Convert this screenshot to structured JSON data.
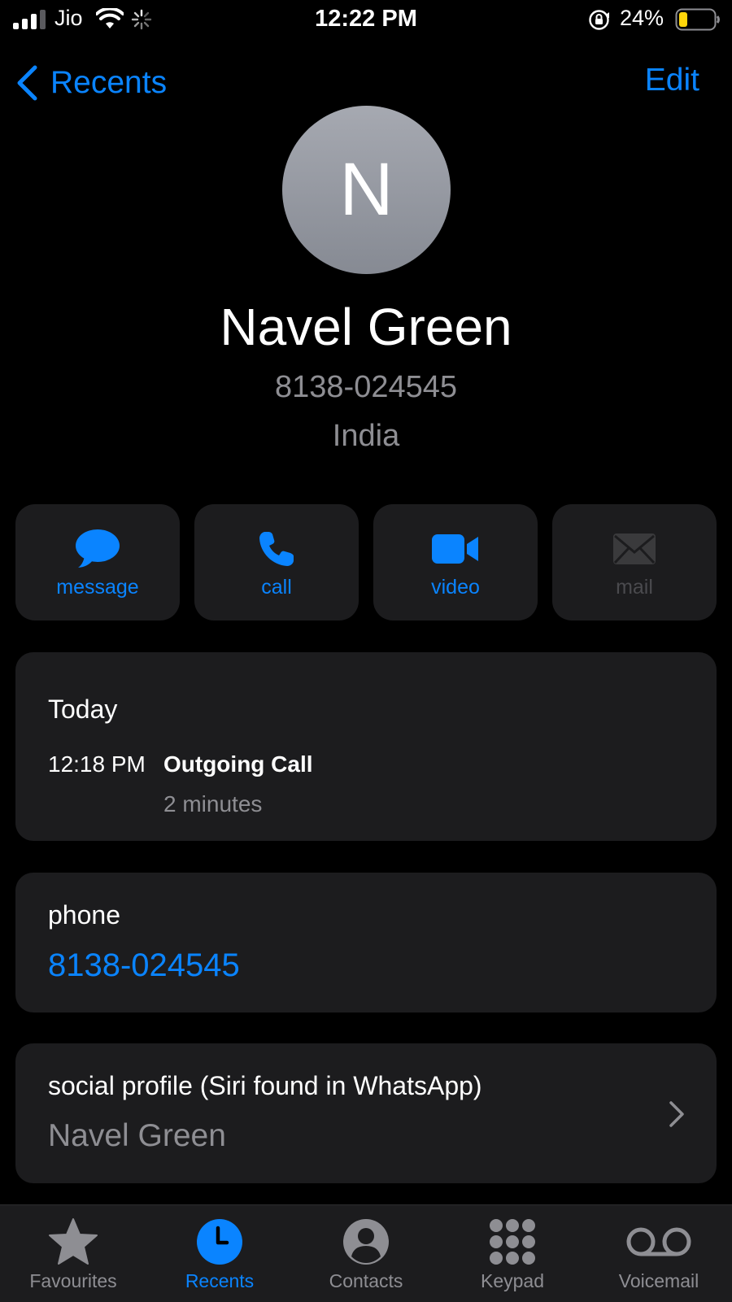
{
  "status_bar": {
    "carrier": "Jio",
    "time": "12:22 PM",
    "battery_percent": "24%",
    "battery_level": 0.24,
    "battery_color": "#ffd60a"
  },
  "nav": {
    "back_label": "Recents",
    "edit_label": "Edit"
  },
  "contact": {
    "initial": "N",
    "name": "Navel Green",
    "number": "8138-024545",
    "country": "India"
  },
  "actions": [
    {
      "label": "message",
      "icon": "message-bubble-icon",
      "enabled": true
    },
    {
      "label": "call",
      "icon": "phone-icon",
      "enabled": true
    },
    {
      "label": "video",
      "icon": "video-camera-icon",
      "enabled": true
    },
    {
      "label": "mail",
      "icon": "mail-envelope-icon",
      "enabled": false
    }
  ],
  "recent_call": {
    "day": "Today",
    "time": "12:18 PM",
    "type": "Outgoing Call",
    "duration": "2 minutes"
  },
  "phone_field": {
    "label": "phone",
    "value": "8138-024545"
  },
  "social_profile": {
    "label": "social profile (Siri found in WhatsApp)",
    "name": "Navel Green"
  },
  "tab_bar": {
    "active": "Recents",
    "tabs": [
      {
        "label": "Favourites",
        "icon": "star-icon"
      },
      {
        "label": "Recents",
        "icon": "clock-icon"
      },
      {
        "label": "Contacts",
        "icon": "person-circle-icon"
      },
      {
        "label": "Keypad",
        "icon": "keypad-grid-icon"
      },
      {
        "label": "Voicemail",
        "icon": "voicemail-icon"
      }
    ]
  },
  "colors": {
    "accent": "#0a84ff",
    "background": "#000000",
    "card": "#1c1c1e",
    "secondary_text": "#8e8e93"
  }
}
